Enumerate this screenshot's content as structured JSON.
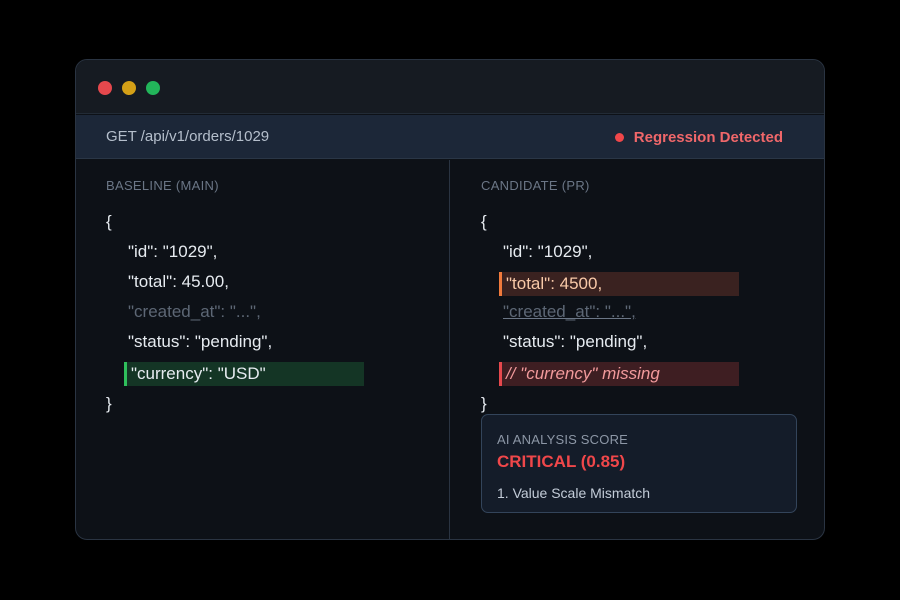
{
  "request": {
    "endpoint": "GET /api/v1/orders/1029",
    "status_label": "Regression Detected",
    "status_color": "#f0474a"
  },
  "baseline": {
    "title": "BASELINE (MAIN)",
    "open_brace": "{",
    "lines": [
      "\"id\": \"1029\",",
      "\"total\": 45.00,",
      "\"created_at\": \"...\",",
      "\"status\": \"pending\",",
      "\"currency\": \"USD\""
    ],
    "close_brace": "}"
  },
  "candidate": {
    "title": "CANDIDATE (PR)",
    "open_brace": "{",
    "lines": [
      "\"id\": \"1029\",",
      "\"total\": 4500,",
      "\"created_at\": \"...\",",
      "\"status\": \"pending\",",
      "// \"currency\" missing"
    ],
    "close_brace": "}"
  },
  "analysis": {
    "label": "AI ANALYSIS SCORE",
    "score": "CRITICAL (0.85)",
    "items": [
      "1. Value Scale Mismatch"
    ]
  },
  "colors": {
    "added": "#2fbf5c",
    "changed": "#f07a3c",
    "removed": "#e5484d"
  },
  "icons": {
    "window_controls": [
      "close-dot",
      "minimize-dot",
      "maximize-dot"
    ],
    "status": "alert-dot-icon"
  }
}
